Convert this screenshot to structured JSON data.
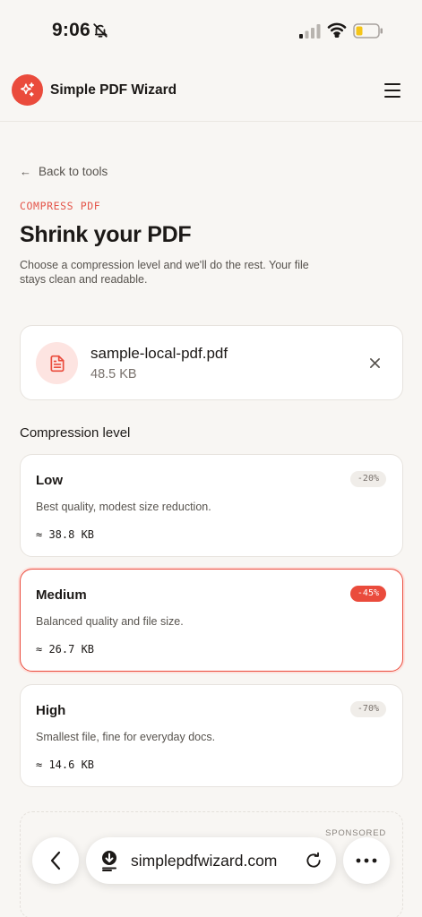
{
  "status_bar": {
    "time": "9:06",
    "icons": [
      "bell-off-icon",
      "signal-icon",
      "wifi-icon",
      "battery-icon"
    ]
  },
  "header": {
    "app_title": "Simple PDF Wizard",
    "logo_icon": "sparkle-icon",
    "menu_icon": "hamburger-menu-icon"
  },
  "main": {
    "back_label": "Back to tools",
    "eyebrow": "COMPRESS PDF",
    "title": "Shrink your PDF",
    "subtitle": "Choose a compression level and we'll do the rest. Your file stays clean and readable."
  },
  "file": {
    "name": "sample-local-pdf.pdf",
    "size": "48.5 KB",
    "icon": "document-icon",
    "remove_icon": "close-icon"
  },
  "compression": {
    "label": "Compression level",
    "selected": "Medium",
    "levels": [
      {
        "name": "Low",
        "badge": "-20%",
        "description": "Best quality, modest size reduction.",
        "estimate": "≈ 38.8 KB"
      },
      {
        "name": "Medium",
        "badge": "-45%",
        "description": "Balanced quality and file size.",
        "estimate": "≈ 26.7 KB"
      },
      {
        "name": "High",
        "badge": "-70%",
        "description": "Smallest file, fine for everyday docs.",
        "estimate": "≈ 14.6 KB"
      }
    ]
  },
  "ad": {
    "label": "SPONSORED"
  },
  "browser": {
    "url": "simplepdfwizard.com",
    "icons": [
      "back-icon",
      "download-icon",
      "reload-icon",
      "more-icon"
    ]
  },
  "colors": {
    "accent": "#ea4b3c",
    "background": "#f8f6f3",
    "card": "#ffffff"
  }
}
